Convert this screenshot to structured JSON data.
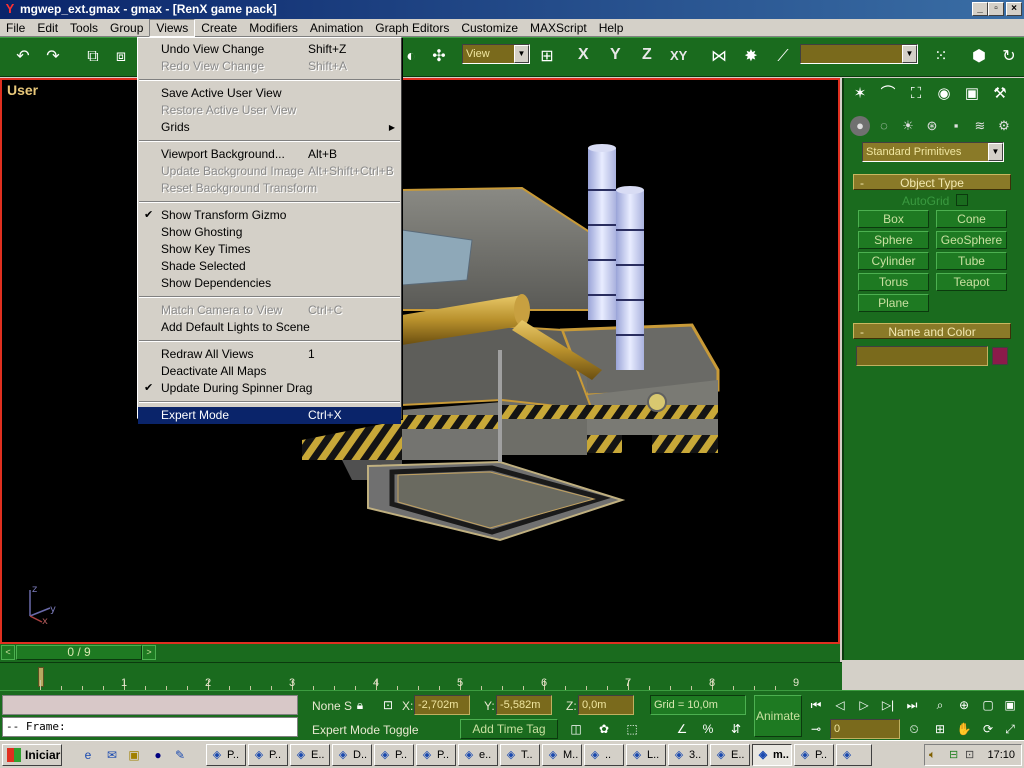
{
  "window": {
    "title": "mgwep_ext.gmax - gmax - [RenX game pack]",
    "buttons": [
      "_",
      "▫",
      "×"
    ]
  },
  "menubar": [
    "File",
    "Edit",
    "Tools",
    "Group",
    "Views",
    "Create",
    "Modifiers",
    "Animation",
    "Graph Editors",
    "Customize",
    "MAXScript",
    "Help"
  ],
  "views_menu": {
    "items": [
      {
        "label": "Undo View Change",
        "shortcut": "Shift+Z",
        "state": "normal"
      },
      {
        "label": "Redo View Change",
        "shortcut": "Shift+A",
        "state": "disabled"
      },
      {
        "sep": true
      },
      {
        "label": "Save Active User View",
        "shortcut": "",
        "state": "normal"
      },
      {
        "label": "Restore Active User View",
        "shortcut": "",
        "state": "disabled"
      },
      {
        "label": "Grids",
        "shortcut": "",
        "state": "normal",
        "submenu": true
      },
      {
        "sep": true
      },
      {
        "label": "Viewport Background...",
        "shortcut": "Alt+B",
        "state": "normal"
      },
      {
        "label": "Update Background Image",
        "shortcut": "Alt+Shift+Ctrl+B",
        "state": "disabled"
      },
      {
        "label": "Reset Background Transform",
        "shortcut": "",
        "state": "disabled"
      },
      {
        "sep": true
      },
      {
        "label": "Show Transform Gizmo",
        "shortcut": "",
        "state": "normal",
        "checked": true
      },
      {
        "label": "Show Ghosting",
        "shortcut": "",
        "state": "normal"
      },
      {
        "label": "Show Key Times",
        "shortcut": "",
        "state": "normal"
      },
      {
        "label": "Shade Selected",
        "shortcut": "",
        "state": "normal"
      },
      {
        "label": "Show Dependencies",
        "shortcut": "",
        "state": "normal"
      },
      {
        "sep": true
      },
      {
        "label": "Match Camera to View",
        "shortcut": "Ctrl+C",
        "state": "disabled"
      },
      {
        "label": "Add Default Lights to Scene",
        "shortcut": "",
        "state": "normal"
      },
      {
        "sep": true
      },
      {
        "label": "Redraw All Views",
        "shortcut": "1",
        "state": "normal"
      },
      {
        "label": "Deactivate All Maps",
        "shortcut": "",
        "state": "normal"
      },
      {
        "label": "Update During Spinner Drag",
        "shortcut": "",
        "state": "normal",
        "checked": true
      },
      {
        "sep": true
      },
      {
        "label": "Expert Mode",
        "shortcut": "Ctrl+X",
        "state": "selected"
      }
    ]
  },
  "toolbar": {
    "view_combo": "View",
    "axis_x": "X",
    "axis_y": "Y",
    "axis_z": "Z",
    "axis_xy": "XY",
    "selection_set": ""
  },
  "viewport": {
    "label": "User",
    "axis_z": "z",
    "axis_y": "y",
    "axis_x": "x"
  },
  "command_panel": {
    "category_combo": "Standard Primitives",
    "object_type_title": "Object Type",
    "object_type_toggle": "-",
    "autogrid": "AutoGrid",
    "buttons": [
      "Box",
      "Cone",
      "Sphere",
      "GeoSphere",
      "Cylinder",
      "Tube",
      "Torus",
      "Teapot",
      "Plane"
    ],
    "name_color_title": "Name and Color",
    "name_color_toggle": "-",
    "name_value": "",
    "color_swatch": "#8b1a4a"
  },
  "timeline": {
    "frame_slider": "0 / 9",
    "ticks": [
      "1",
      "2",
      "3",
      "4",
      "5",
      "6",
      "7",
      "8",
      "9"
    ],
    "arrow_left": "<",
    "arrow_right": ">"
  },
  "statusbar": {
    "maxscript_line2": "-- Frame:",
    "selection": "None S",
    "x_label": "X:",
    "x_value": "-2,702m",
    "y_label": "Y:",
    "y_value": "-5,582m",
    "z_label": "Z:",
    "z_value": "0,0m",
    "grid": "Grid = 10,0m",
    "prompt": "Expert Mode Toggle",
    "add_time_tag": "Add Time Tag",
    "animate": "Animate",
    "frame_value": "0"
  },
  "taskbar": {
    "start": "Iniciar",
    "tasks": [
      "P..",
      "P..",
      "E..",
      "D..",
      "P..",
      "P..",
      "e..",
      "T..",
      "M..",
      "..",
      "L..",
      "3..",
      "E..",
      "m..",
      "P..",
      ""
    ],
    "pressed_index": 13,
    "clock": "17:10"
  }
}
